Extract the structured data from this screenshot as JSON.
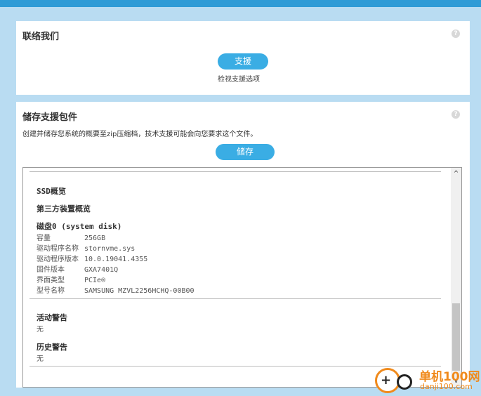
{
  "contact": {
    "title": "联络我们",
    "help_glyph": "?",
    "support_button": "支援",
    "view_options_text": "检视支援选项"
  },
  "save_package": {
    "title": "储存支援包件",
    "help_glyph": "?",
    "description": "创建并储存您系统的概要至zip压缩档，技术支援可能会向您要求这个文件。",
    "save_button": "储存"
  },
  "report": {
    "ssd_overview": "SSD概览",
    "third_party_overview": "第三方装置概览",
    "disk_heading": "磁盘0 (system disk)",
    "disk_rows": [
      {
        "key": "容量",
        "value": "256GB"
      },
      {
        "key": "驱动程序名称",
        "value": "stornvme.sys"
      },
      {
        "key": "驱动程序版本",
        "value": "10.0.19041.4355"
      },
      {
        "key": "固件版本",
        "value": "GXA7401Q"
      },
      {
        "key": "界面类型",
        "value": "PCIe®"
      },
      {
        "key": "型号名称",
        "value": "SAMSUNG MZVL2256HCHQ-00B00"
      }
    ],
    "active_alerts_heading": "活动警告",
    "active_alerts_value": "无",
    "history_alerts_heading": "历史警告",
    "history_alerts_value": "无"
  },
  "scrollbar": {
    "up_arrow": "^",
    "down_arrow": "v"
  },
  "watermark": {
    "name": "单机100网",
    "url": "danji100.com",
    "logo_glyph": "+"
  }
}
